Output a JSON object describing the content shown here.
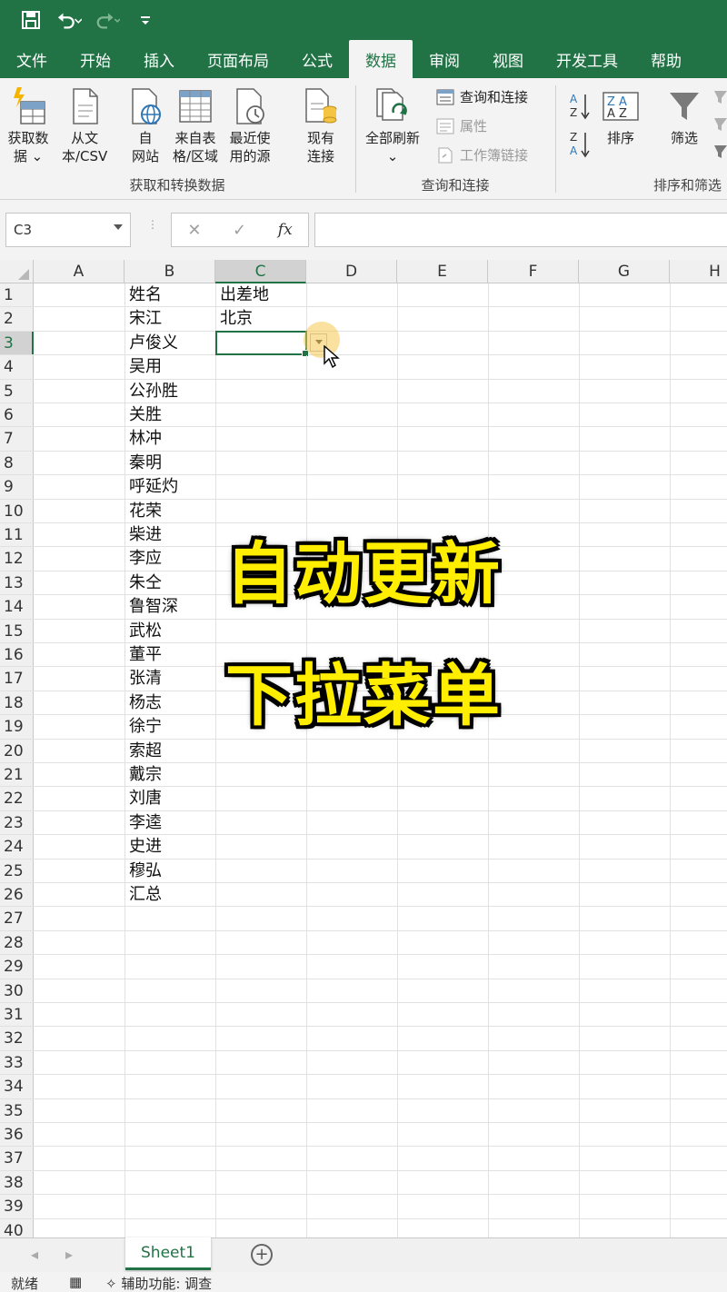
{
  "titlebar": {
    "icons": [
      "save-icon",
      "undo-icon",
      "redo-icon",
      "customize-quick-access-icon"
    ]
  },
  "tabs": [
    {
      "label": "文件",
      "active": false
    },
    {
      "label": "开始",
      "active": false
    },
    {
      "label": "插入",
      "active": false
    },
    {
      "label": "页面布局",
      "active": false
    },
    {
      "label": "公式",
      "active": false
    },
    {
      "label": "数据",
      "active": true
    },
    {
      "label": "审阅",
      "active": false
    },
    {
      "label": "视图",
      "active": false
    },
    {
      "label": "开发工具",
      "active": false
    },
    {
      "label": "帮助",
      "active": false
    }
  ],
  "ribbon": {
    "get_transform": {
      "group_label": "获取和转换数据",
      "get_data": "获取数\n据 ⌄",
      "from_text": "从文\n本/CSV",
      "from_web": "自\n网站",
      "from_table": "来自表\n格/区域",
      "recent_sources": "最近使\n用的源",
      "existing_connections": "现有\n连接"
    },
    "queries": {
      "group_label": "查询和连接",
      "refresh_all": "全部刷新\n⌄",
      "queries_connections": "查询和连接",
      "properties": "属性",
      "edit_links": "工作簿链接"
    },
    "sort_filter": {
      "group_label": "排序和筛选",
      "sort": "排序",
      "filter": "筛选"
    }
  },
  "formula_bar": {
    "name_box": "C3",
    "cancel": "✕",
    "enter": "✓",
    "fx": "fx",
    "value": ""
  },
  "grid": {
    "columns": [
      "A",
      "B",
      "C",
      "D",
      "E",
      "F",
      "G",
      "H"
    ],
    "selected_column": "C",
    "selected_row": 3,
    "row_count": 40,
    "cells": {
      "B": [
        "姓名",
        "宋江",
        "卢俊义",
        "吴用",
        "公孙胜",
        "关胜",
        "林冲",
        "秦明",
        "呼延灼",
        "花荣",
        "柴进",
        "李应",
        "朱仝",
        "鲁智深",
        "武松",
        "董平",
        "张清",
        "杨志",
        "徐宁",
        "索超",
        "戴宗",
        "刘唐",
        "李逵",
        "史进",
        "穆弘",
        "汇总"
      ],
      "C": [
        "出差地",
        "北京"
      ]
    }
  },
  "overlay": {
    "line1": "自动更新",
    "line2": "下拉菜单",
    "color": "#ffee00"
  },
  "sheets": {
    "tabs": [
      "Sheet1"
    ],
    "add": "+"
  },
  "status": {
    "ready": "就绪",
    "accessibility": "辅助功能: 调查"
  },
  "colors": {
    "accent": "#217346"
  }
}
